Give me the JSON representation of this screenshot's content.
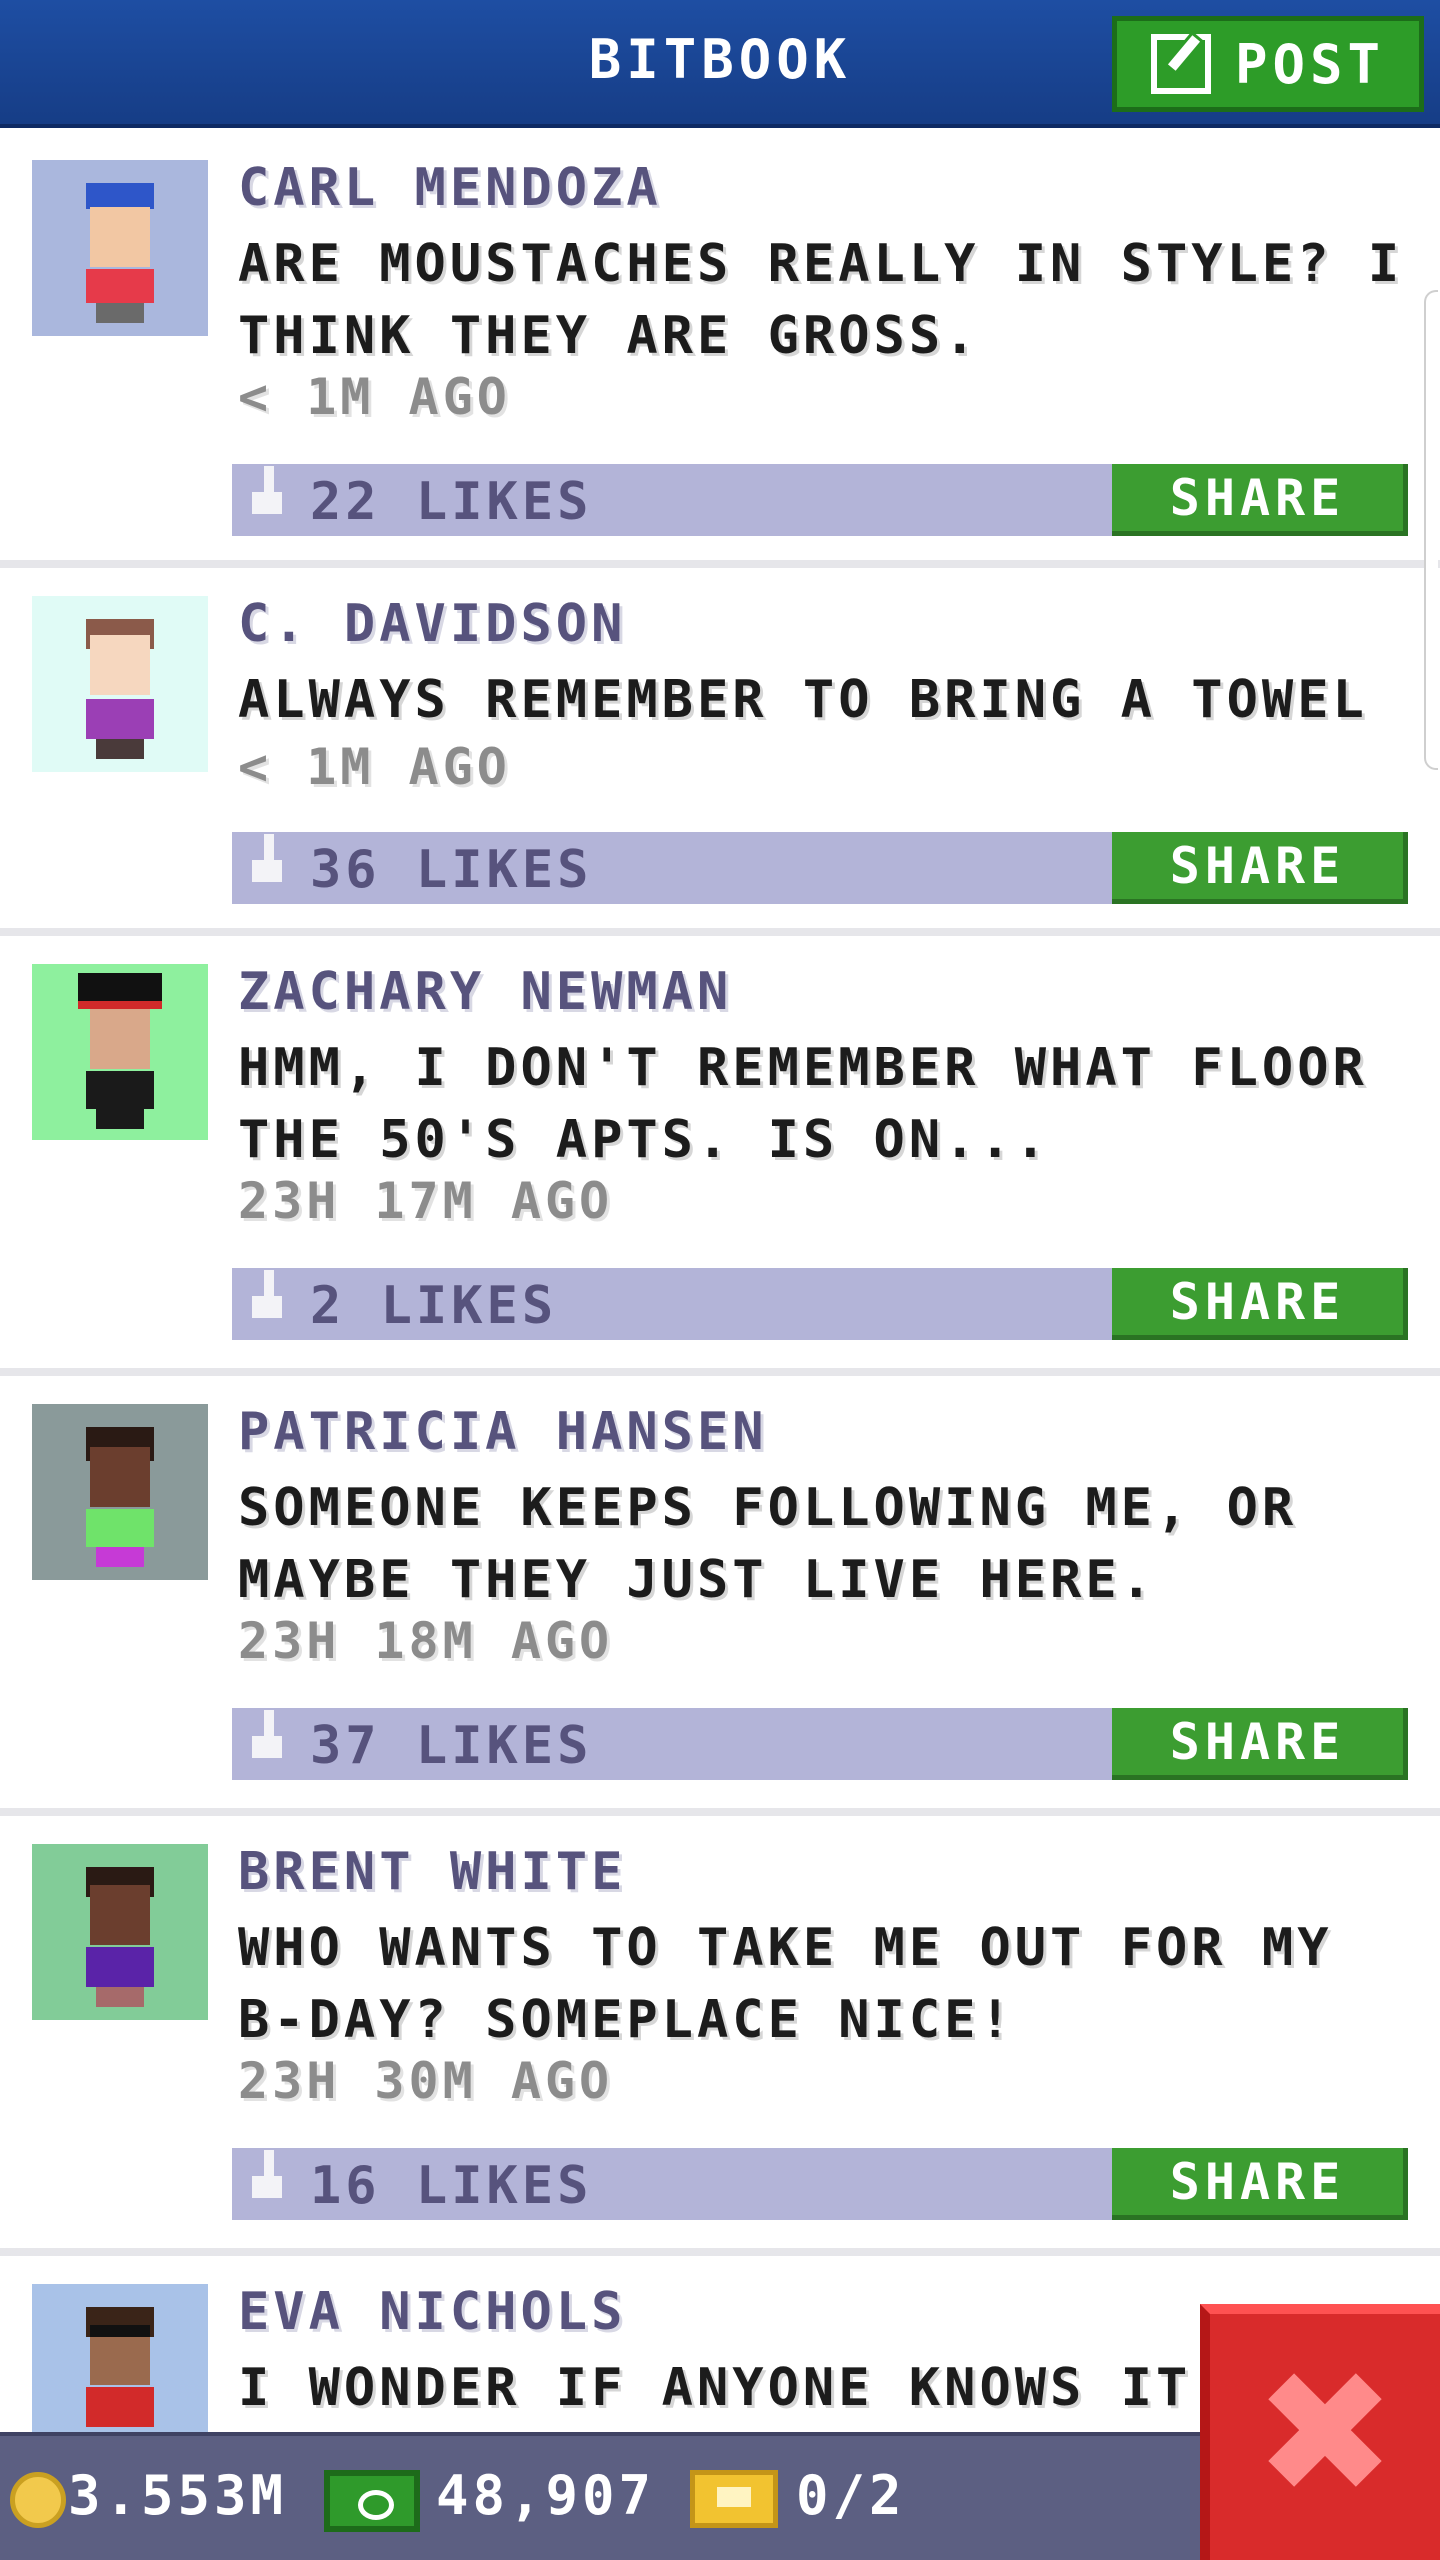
{
  "header": {
    "title": "BITBOOK",
    "post_label": "POST",
    "post_icon": "edit-icon"
  },
  "feed": {
    "share_label": "SHARE",
    "posts": [
      {
        "name": "CARL MENDOZA",
        "message": "ARE MOUSTACHES REALLY IN STYLE? I THINK THEY ARE GROSS.",
        "time": "< 1M AGO",
        "likes": "22 LIKES",
        "avatar": {
          "bg": "#aab7dd",
          "hair": "#2e56c9",
          "shirt": "#e63a4a",
          "skin": "#f2c7a3"
        }
      },
      {
        "name": "C. DAVIDSON",
        "message": "ALWAYS REMEMBER TO BRING A TOWEL",
        "time": "< 1M AGO",
        "likes": "36 LIKES",
        "avatar": {
          "bg": "#e0fbf6",
          "hair": "#8b5a4a",
          "shirt": "#9b3fb5",
          "skin": "#f6d7bf"
        }
      },
      {
        "name": "ZACHARY NEWMAN",
        "message": "HMM, I DON'T REMEMBER WHAT FLOOR THE 50'S APTS. IS ON...",
        "time": "23H 17M AGO",
        "likes": "2 LIKES",
        "avatar": {
          "bg": "#8ef09e",
          "hair": "#111111",
          "shirt": "#1a1a1a",
          "skin": "#d9a88a"
        }
      },
      {
        "name": "PATRICIA HANSEN",
        "message": "SOMEONE KEEPS FOLLOWING ME, OR MAYBE THEY JUST LIVE HERE.",
        "time": "23H 18M AGO",
        "likes": "37 LIKES",
        "avatar": {
          "bg": "#8a9a9a",
          "hair": "#2a1a14",
          "shirt": "#6fe36a",
          "skin": "#6b3e2e"
        }
      },
      {
        "name": "BRENT WHITE",
        "message": "WHO WANTS TO TAKE ME OUT FOR MY B-DAY? SOMEPLACE NICE!",
        "time": "23H 30M AGO",
        "likes": "16 LIKES",
        "avatar": {
          "bg": "#82cc98",
          "hair": "#2a1a14",
          "shirt": "#5a23a8",
          "skin": "#6b3e2e"
        }
      },
      {
        "name": "EVA NICHOLS",
        "message": "I WONDER IF ANYONE KNOWS IT'",
        "time": "",
        "likes": "",
        "avatar": {
          "bg": "#a9c2e8",
          "hair": "#3a2418",
          "shirt": "#d22a2a",
          "skin": "#9a6a4e"
        }
      }
    ]
  },
  "bottom_bar": {
    "coins": "3.553M",
    "coins_icon": "coin-icon",
    "bux": "48,907",
    "bux_icon": "cash-icon",
    "tickets": "0/2",
    "tickets_icon": "ticket-icon"
  },
  "close_icon": "close-icon",
  "colors": {
    "header_blue": "#1e4ea3",
    "green": "#3c9d31",
    "likes_bar": "#b3b4d8",
    "name_purple": "#57537d",
    "close_red": "#d92b2b"
  }
}
